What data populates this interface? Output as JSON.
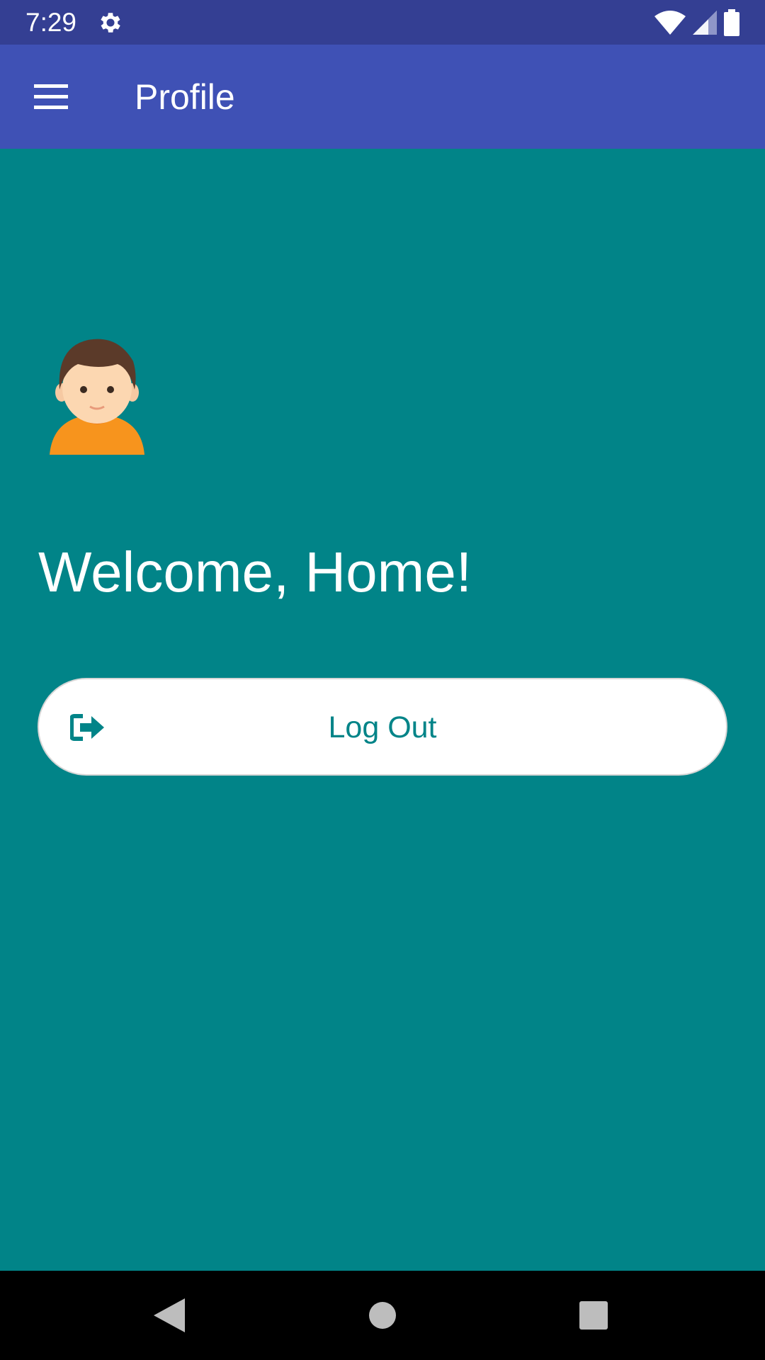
{
  "status_bar": {
    "time": "7:29",
    "icons": [
      "gear-icon",
      "wifi-icon",
      "signal-icon",
      "battery-icon"
    ]
  },
  "app_bar": {
    "title": "Profile",
    "menu_icon": "hamburger-menu-icon",
    "background": "#3F51B5"
  },
  "profile": {
    "avatar_icon": "person-avatar-icon",
    "welcome_text": "Welcome, Home!",
    "logout_label": "Log Out",
    "logout_icon": "logout-icon"
  },
  "nav_bar": {
    "icons": [
      "back-icon",
      "home-icon",
      "recents-icon"
    ]
  },
  "colors": {
    "status_bar": "#343F93",
    "app_bar": "#3F51B5",
    "content_bg": "#018488",
    "button_bg": "#FFFFFF",
    "button_text": "#018488"
  }
}
